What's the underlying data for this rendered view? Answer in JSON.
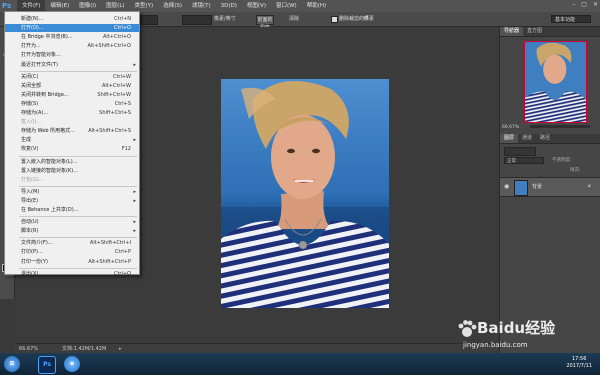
{
  "menubar": {
    "logo": "Ps",
    "items": [
      "文件(F)",
      "编辑(E)",
      "图像(I)",
      "图层(L)",
      "类型(Y)",
      "选择(S)",
      "滤镜(T)",
      "3D(D)",
      "视图(V)",
      "窗口(W)",
      "帮助(H)"
    ],
    "win_min": "–",
    "win_max": "▢",
    "win_close": "✕"
  },
  "options": {
    "unit": "像素/英寸",
    "front_image": "前面的图像",
    "clear": "清除",
    "delete_cropped": "删除裁剪的像素",
    "workspace": "基本功能"
  },
  "file_menu": {
    "items": [
      {
        "label": "新建(N)...",
        "shortcut": "Ctrl+N"
      },
      {
        "label": "打开(O)...",
        "shortcut": "Ctrl+O",
        "highlight": true
      },
      {
        "label": "在 Bridge 中浏览(B)...",
        "shortcut": "Alt+Ctrl+O"
      },
      {
        "label": "打开为...",
        "shortcut": "Alt+Shift+Ctrl+O"
      },
      {
        "label": "打开为智能对象...",
        "shortcut": ""
      },
      {
        "label": "最近打开文件(T)",
        "shortcut": "",
        "submenu": true
      },
      {
        "label": "关闭(C)",
        "shortcut": "Ctrl+W"
      },
      {
        "label": "关闭全部",
        "shortcut": "Alt+Ctrl+W"
      },
      {
        "label": "关闭并转到 Bridge...",
        "shortcut": "Shift+Ctrl+W"
      },
      {
        "label": "存储(S)",
        "shortcut": "Ctrl+S"
      },
      {
        "label": "存储为(A)...",
        "shortcut": "Shift+Ctrl+S"
      },
      {
        "label": "签入(I)...",
        "shortcut": "",
        "disabled": true
      },
      {
        "label": "存储为 Web 所用格式...",
        "shortcut": "Alt+Shift+Ctrl+S"
      },
      {
        "label": "生成",
        "shortcut": "",
        "submenu": true
      },
      {
        "label": "恢复(V)",
        "shortcut": "F12"
      },
      {
        "label": "置入嵌入的智能对象(L)...",
        "shortcut": ""
      },
      {
        "label": "置入链接的智能对象(K)...",
        "shortcut": ""
      },
      {
        "label": "打包(G)...",
        "shortcut": "",
        "disabled": true
      },
      {
        "label": "导入(M)",
        "shortcut": "",
        "submenu": true
      },
      {
        "label": "导出(E)",
        "shortcut": "",
        "submenu": true
      },
      {
        "label": "在 Behance 上共享(D)...",
        "shortcut": ""
      },
      {
        "label": "自动(U)",
        "shortcut": "",
        "submenu": true
      },
      {
        "label": "脚本(R)",
        "shortcut": "",
        "submenu": true
      },
      {
        "label": "文件简介(F)...",
        "shortcut": "Alt+Shift+Ctrl+I"
      },
      {
        "label": "打印(P)...",
        "shortcut": "Ctrl+P"
      },
      {
        "label": "打印一份(Y)",
        "shortcut": "Alt+Shift+Ctrl+P"
      },
      {
        "label": "退出(X)",
        "shortcut": "Ctrl+Q"
      }
    ]
  },
  "panels": {
    "nav_tabs": [
      "导航器",
      "直方图"
    ],
    "layer_tabs": [
      "图层",
      "通道",
      "路径"
    ],
    "blend_mode": "正常",
    "opacity_label": "不透明度:",
    "fill_label": "填充:",
    "layer_name": "背景",
    "zoom_field": "66.67%"
  },
  "status": {
    "zoom": "66.67%",
    "doc": "文档:1.42M/1.42M"
  },
  "taskbar": {
    "time": "17:56",
    "date": "2017/7/11"
  },
  "watermark": {
    "brand": "Baidu经验",
    "url": "jingyan.baidu.com"
  }
}
